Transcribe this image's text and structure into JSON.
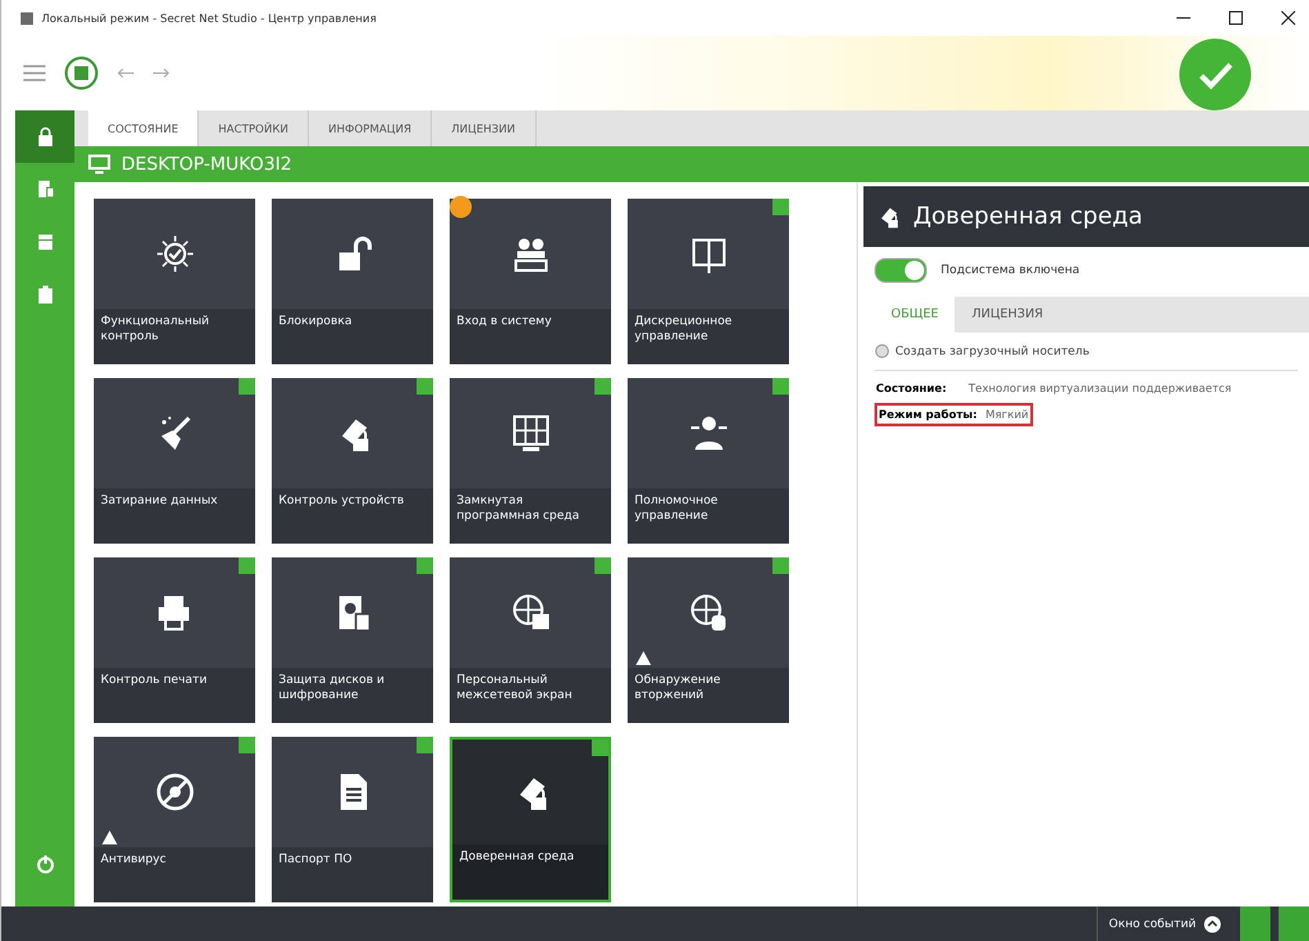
{
  "window": {
    "title": "Локальный режим - Secret Net Studio - Центр управления"
  },
  "sidebar": {
    "items": [
      {
        "selected": true
      },
      {
        "selected": false
      },
      {
        "selected": false
      },
      {
        "selected": false
      }
    ]
  },
  "tabs": [
    {
      "label": "СОСТОЯНИЕ",
      "selected": true
    },
    {
      "label": "НАСТРОЙКИ",
      "selected": false
    },
    {
      "label": "ИНФОРМАЦИЯ",
      "selected": false
    },
    {
      "label": "ЛИЦЕНЗИИ",
      "selected": false
    }
  ],
  "computer": {
    "name": "DESKTOP-MUKO3I2"
  },
  "tiles": [
    {
      "label": "Функциональный контроль",
      "alert": false,
      "selected": false
    },
    {
      "label": "Блокировка",
      "alert": false,
      "selected": false
    },
    {
      "label": "Вход в систему",
      "color": "#f19a1c",
      "alert": false,
      "selected": false
    },
    {
      "label": "Дискреционное управление",
      "color": "#44b43a",
      "alert": false,
      "selected": false
    },
    {
      "label": "Затирание данных",
      "color": "#44b43a",
      "alert": false,
      "selected": false
    },
    {
      "label": "Контроль устройств",
      "color": "#44b43a",
      "alert": false,
      "selected": false
    },
    {
      "label": "Замкнутая программная среда",
      "color": "#44b43a",
      "alert": false,
      "selected": false
    },
    {
      "label": "Полномочное управление",
      "color": "#44b43a",
      "alert": false,
      "selected": false
    },
    {
      "label": "Контроль печати",
      "color": "#44b43a",
      "alert": false,
      "selected": false
    },
    {
      "label": "Защита дисков и шифрование",
      "color": "#44b43a",
      "alert": false,
      "selected": false
    },
    {
      "label": "Персональный межсетевой экран",
      "color": "#44b43a",
      "alert": false,
      "selected": false
    },
    {
      "label": "Обнаружение вторжений",
      "color": "#44b43a",
      "alert": true,
      "selected": false
    },
    {
      "label": "Антивирус",
      "color": "#44b43a",
      "alert": true,
      "selected": false
    },
    {
      "label": "Паспорт ПО",
      "color": "#44b43a",
      "alert": false,
      "selected": false
    },
    {
      "label": "Доверенная среда",
      "color": "#44b43a",
      "alert": false,
      "selected": true
    }
  ],
  "details": {
    "title": "Доверенная среда",
    "toggle": {
      "label": "Подсистема включена",
      "on": true
    },
    "tabs": [
      {
        "label": "ОБЩЕЕ",
        "selected": true
      },
      {
        "label": "ЛИЦЕНЗИЯ",
        "selected": false
      }
    ],
    "action": "Создать загрузочный носитель",
    "fields": [
      {
        "label": "Состояние:",
        "value": "Технология виртуализации поддерживается",
        "highlighted": false
      },
      {
        "label": "Режим работы:",
        "value": "Мягкий",
        "highlighted": true
      }
    ]
  },
  "status_bar": {
    "events": "Окно событий"
  }
}
